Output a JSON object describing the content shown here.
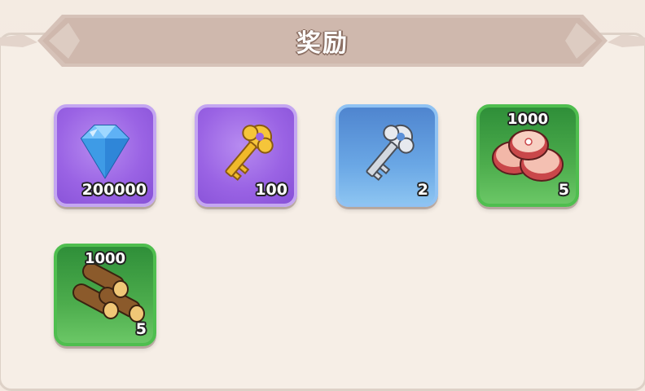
{
  "header": {
    "title": "奖励"
  },
  "rewards": [
    {
      "item": "diamond",
      "icon": "diamond-icon",
      "quantity": "200000",
      "amount": "",
      "frame": "purple"
    },
    {
      "item": "gold-key",
      "icon": "gold-key-icon",
      "quantity": "100",
      "amount": "",
      "frame": "purple"
    },
    {
      "item": "silver-key",
      "icon": "silver-key-icon",
      "quantity": "2",
      "amount": "",
      "frame": "blue"
    },
    {
      "item": "meat",
      "icon": "meat-icon",
      "quantity": "5",
      "amount": "1000",
      "frame": "green"
    },
    {
      "item": "wood",
      "icon": "wood-logs-icon",
      "quantity": "5",
      "amount": "1000",
      "frame": "green"
    }
  ],
  "colors": {
    "background": "#f3e9e0",
    "ribbon": "#d2bcb2",
    "purple_frame": "#9a63e4",
    "blue_frame": "#6aa7e5",
    "green_frame": "#4dad4d"
  }
}
